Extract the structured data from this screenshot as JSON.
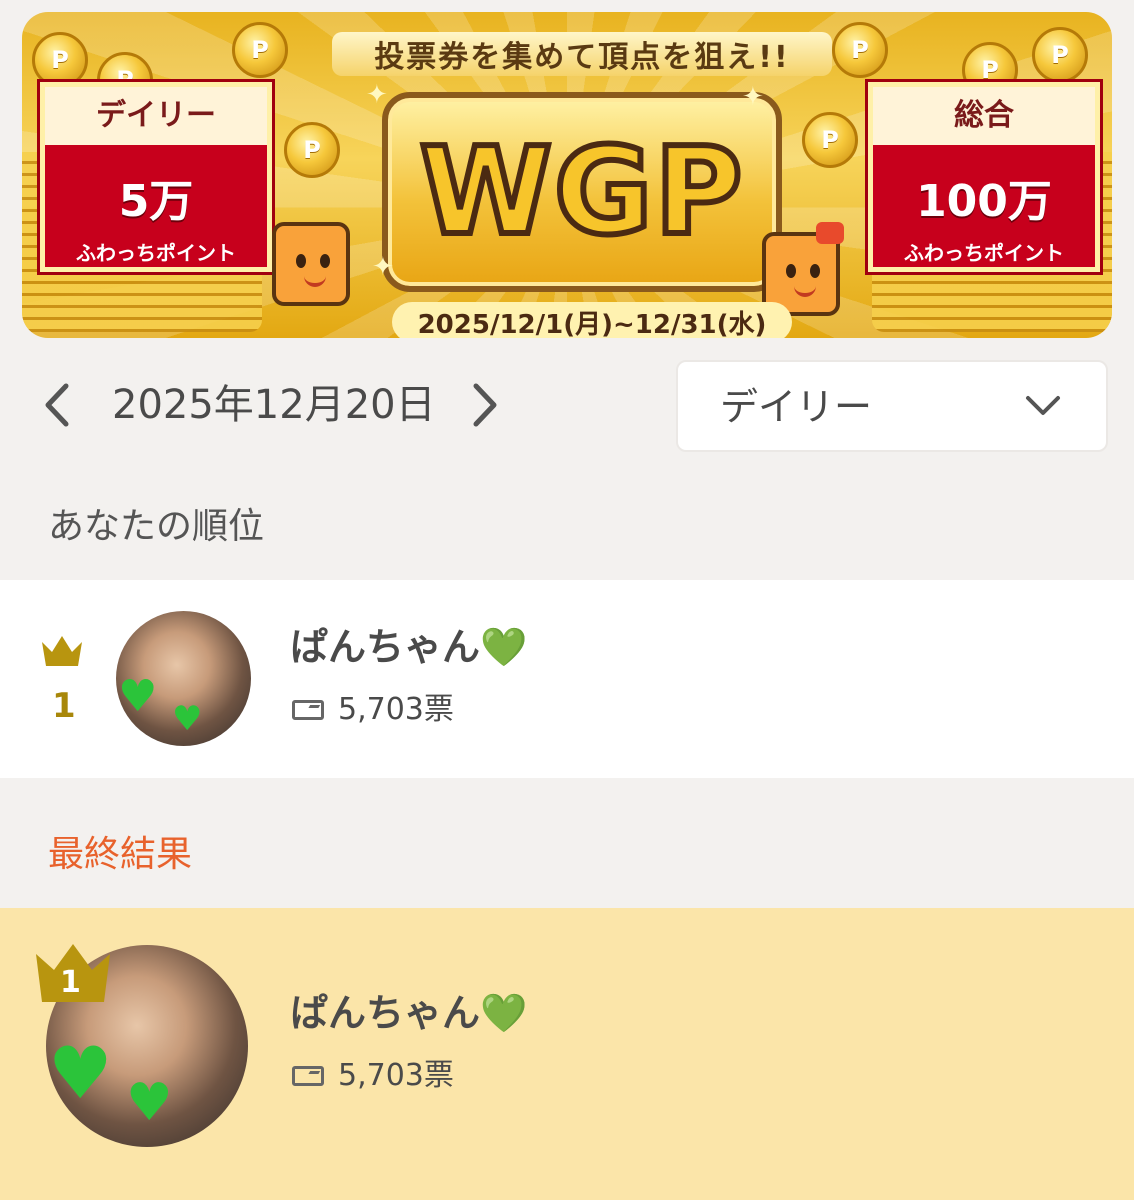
{
  "banner": {
    "tagline": "投票券を集めて頂点を狙え!!",
    "logo_text": "WGP",
    "left_panel": {
      "title": "デイリー",
      "amount": "5万",
      "unit": "ふわっちポイント"
    },
    "right_panel": {
      "title": "総合",
      "amount": "100万",
      "unit": "ふわっちポイント"
    },
    "date_range": "2025/12/1(月)~12/31(水)",
    "coin_label": "P"
  },
  "date_nav": {
    "date": "2025年12月20日",
    "prev_icon": "chevron-left-icon",
    "next_icon": "chevron-right-icon"
  },
  "period_select": {
    "selected": "デイリー",
    "icon": "chevron-down-icon"
  },
  "your_rank": {
    "heading": "あなたの順位",
    "rank": "1",
    "name": "ぱんちゃん💚",
    "votes": "5,703票"
  },
  "final_result": {
    "heading": "最終結果",
    "heading_color": "#e8622c",
    "rank": "1",
    "name": "ぱんちゃん💚",
    "votes": "5,703票"
  },
  "colors": {
    "crown": "#b8950f",
    "gold_row": "#fbe5a9",
    "background": "#f3f1ef"
  }
}
